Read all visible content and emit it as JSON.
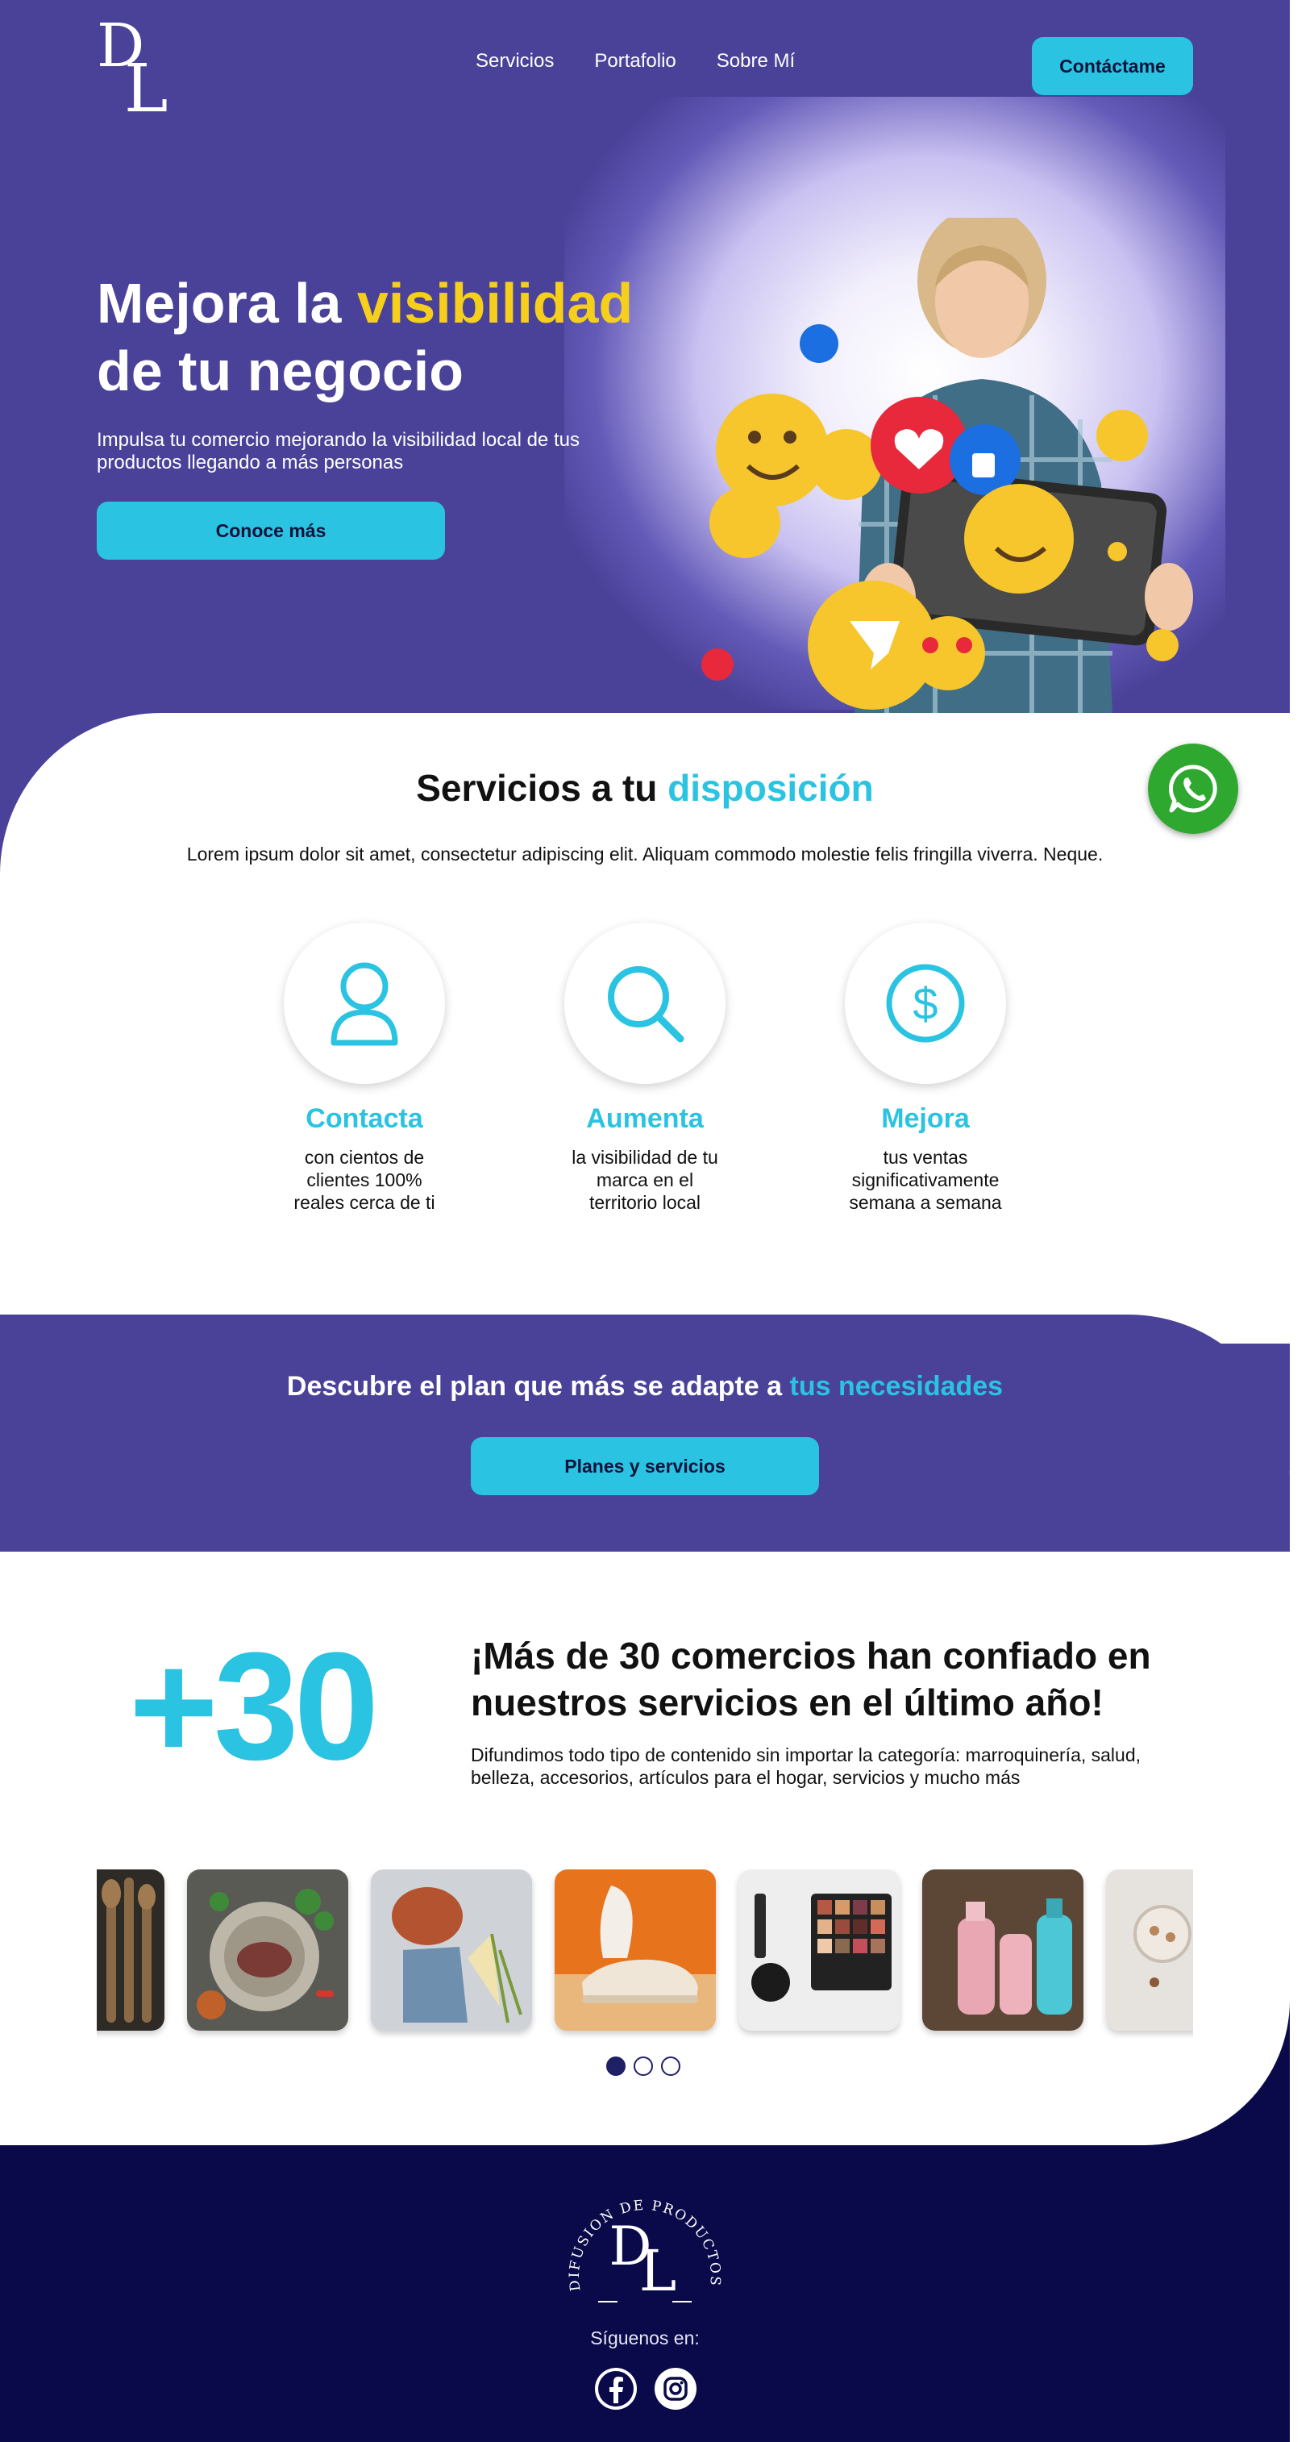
{
  "brand": {
    "logo_letters": "DL",
    "footer_logo_ring_text": "DIFUSION DE PRODUCTOS"
  },
  "nav": {
    "items": [
      "Servicios",
      "Portafolio",
      "Sobre Mí"
    ],
    "contact_label": "Contáctame"
  },
  "hero": {
    "title_part1": "Mejora la ",
    "title_highlight": "visibilidad",
    "title_part2": "de tu negocio",
    "subtitle": "Impulsa tu comercio mejorando la visibilidad local de tus productos llegando a más personas",
    "cta_label": "Conoce más",
    "image": "woman-tablet-emojis"
  },
  "services": {
    "title_part1": "Servicios a tu ",
    "title_highlight": "disposición",
    "description": "Lorem ipsum dolor sit amet, consectetur adipiscing elit. Aliquam commodo molestie felis fringilla viverra. Neque.",
    "features": [
      {
        "icon": "user-icon",
        "title": "Contacta",
        "desc": "con cientos de clientes 100% reales cerca de ti"
      },
      {
        "icon": "search-icon",
        "title": "Aumenta",
        "desc": "la visibilidad de tu marca en el territorio local"
      },
      {
        "icon": "dollar-icon",
        "title": "Mejora",
        "desc": "tus ventas significativamente semana a semana"
      }
    ]
  },
  "plans": {
    "title_part1": "Descubre el plan que más se adapte a ",
    "title_highlight": "tus necesidades",
    "cta_label": "Planes y servicios"
  },
  "stats": {
    "big_number": "+30",
    "title": "¡Más de 30 comercios han confiado en nuestros servicios en el último año!",
    "description": "Difundimos todo tipo de contenido sin importar la categoría: marroquinería, salud, belleza, accesorios, artículos para el hogar, servicios y mucho más"
  },
  "gallery": {
    "images": [
      "wooden-utensils",
      "food-plate",
      "clothing-flatlay",
      "sneaker",
      "makeup-palette",
      "cosmetic-bottles",
      "jewelry"
    ],
    "dots": 3,
    "active_dot": 0
  },
  "footer": {
    "follow_label": "Síguenos en:",
    "social": [
      "facebook-icon",
      "instagram-icon"
    ]
  },
  "colors": {
    "purple": "#4a4299",
    "cyan": "#2bc3e2",
    "yellow": "#f6cf1c",
    "navy": "#0a0a4a",
    "whatsapp": "#2ea82f"
  }
}
